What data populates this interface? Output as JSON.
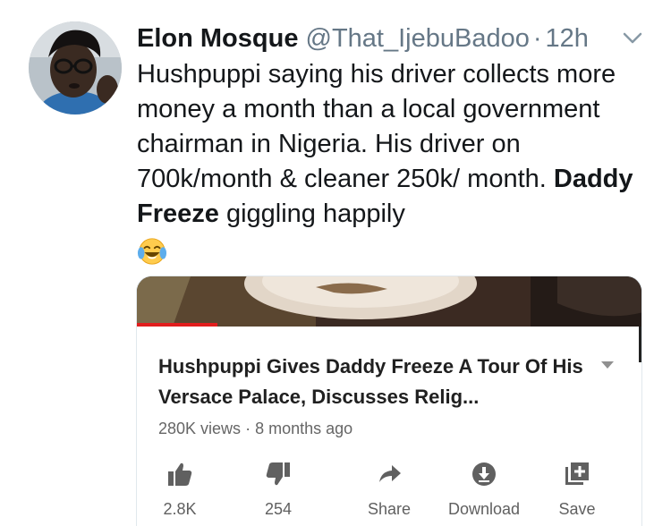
{
  "tweet": {
    "author_name": "Elon Mosque",
    "handle": "@That_IjebuBadoo",
    "separator": "·",
    "timestamp": "12h",
    "text_part1": "Hushpuppi saying his driver collects more money a month than a local government chairman in Nigeria. His driver on 700k/month & cleaner 250k/ month. ",
    "mention": "Daddy Freeze",
    "text_part2": " giggling happily",
    "emoji": "face-with-tears-of-joy"
  },
  "video_card": {
    "title": "Hushpuppi Gives Daddy Freeze A Tour Of His Versace Palace, Discusses Relig...",
    "views": "280K views",
    "age": "8 months ago",
    "meta_separator": "·",
    "actions": {
      "like_count": "2.8K",
      "dislike_count": "254",
      "share_label": "Share",
      "download_label": "Download",
      "save_label": "Save"
    }
  },
  "colors": {
    "text_primary": "#14171a",
    "text_secondary": "#657786",
    "card_border": "#e1e8ed",
    "icon_gray": "#606060"
  }
}
